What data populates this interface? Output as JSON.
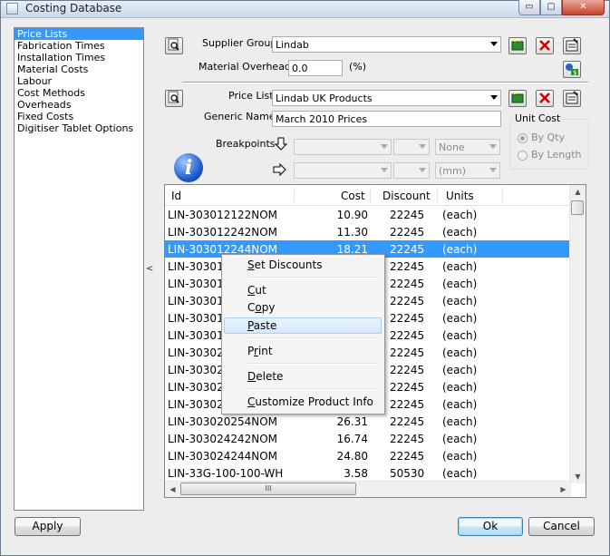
{
  "window": {
    "title": "Costing Database",
    "controls": {
      "minimize": "▭",
      "maximize": "▢",
      "close": "✕"
    }
  },
  "sidebar": {
    "items": [
      {
        "label": "Price Lists",
        "selected": true
      },
      {
        "label": "Fabrication Times",
        "selected": false
      },
      {
        "label": "Installation Times",
        "selected": false
      },
      {
        "label": "Material Costs",
        "selected": false
      },
      {
        "label": "Labour",
        "selected": false
      },
      {
        "label": "Cost Methods",
        "selected": false
      },
      {
        "label": "Overheads",
        "selected": false
      },
      {
        "label": "Fixed Costs",
        "selected": false
      },
      {
        "label": "Digitiser Tablet Options",
        "selected": false
      }
    ],
    "splitter_glyph": "<"
  },
  "supplier": {
    "group_label": "Supplier Group",
    "group_value": "Lindab",
    "overheads_label": "Material Overheads",
    "overheads_value": "0.0",
    "overheads_unit": "(%)"
  },
  "pricelist": {
    "label": "Price List",
    "value": "Lindab UK Products",
    "generic_name_label": "Generic Name",
    "generic_name_value": "March 2010 Prices"
  },
  "breakpoints": {
    "label": "Breakpoints",
    "row1_unit": "None",
    "row2_unit": "(mm)"
  },
  "unit_cost": {
    "legend": "Unit Cost",
    "by_qty": "By Qty",
    "by_length": "By Length",
    "selected": "By Qty"
  },
  "grid": {
    "columns": [
      "Id",
      "Cost",
      "Discount",
      "Units"
    ],
    "rows": [
      {
        "id": "LIN-303012122NOM",
        "cost": "10.90",
        "discount": "22245",
        "units": "(each)"
      },
      {
        "id": "LIN-303012242NOM",
        "cost": "11.30",
        "discount": "22245",
        "units": "(each)"
      },
      {
        "id": "LIN-303012244NOM",
        "cost": "18.21",
        "discount": "22245",
        "units": "(each)",
        "selected": true
      },
      {
        "id": "LIN-303016",
        "cost": "",
        "discount": "22245",
        "units": "(each)"
      },
      {
        "id": "LIN-303016",
        "cost": "",
        "discount": "22245",
        "units": "(each)"
      },
      {
        "id": "LIN-303016",
        "cost": "",
        "discount": "22245",
        "units": "(each)"
      },
      {
        "id": "LIN-303018",
        "cost": "",
        "discount": "22245",
        "units": "(each)"
      },
      {
        "id": "LIN-303018",
        "cost": "",
        "discount": "22245",
        "units": "(each)"
      },
      {
        "id": "LIN-303020",
        "cost": "",
        "discount": "22245",
        "units": "(each)"
      },
      {
        "id": "LIN-303020",
        "cost": "",
        "discount": "22245",
        "units": "(each)"
      },
      {
        "id": "LIN-303020",
        "cost": "",
        "discount": "22245",
        "units": "(each)"
      },
      {
        "id": "LIN-303020",
        "cost": "",
        "discount": "22245",
        "units": "(each)"
      },
      {
        "id": "LIN-303020254NOM",
        "cost": "26.31",
        "discount": "22245",
        "units": "(each)"
      },
      {
        "id": "LIN-303024242NOM",
        "cost": "16.74",
        "discount": "22245",
        "units": "(each)"
      },
      {
        "id": "LIN-303024244NOM",
        "cost": "24.80",
        "discount": "22245",
        "units": "(each)"
      },
      {
        "id": "LIN-33G-100-100-WH",
        "cost": "3.58",
        "discount": "50530",
        "units": "(each)"
      }
    ],
    "hscroll_grip": "III"
  },
  "context_menu": {
    "items": [
      {
        "key": "set_discounts",
        "label": "Set Discounts"
      },
      {
        "key": "cut",
        "label": "Cut"
      },
      {
        "key": "copy",
        "label": "Copy"
      },
      {
        "key": "paste",
        "label": "Paste",
        "highlighted": true
      },
      {
        "key": "print",
        "label": "Print"
      },
      {
        "key": "delete",
        "label": "Delete"
      },
      {
        "key": "customize",
        "label": "Customize Product Info"
      }
    ]
  },
  "footer": {
    "apply": "Apply",
    "ok": "Ok",
    "cancel": "Cancel"
  },
  "colors": {
    "selection": "#3399ff",
    "window_bg": "#ededed",
    "delete_red": "#cc0000",
    "add_green": "#2e8b2e"
  }
}
